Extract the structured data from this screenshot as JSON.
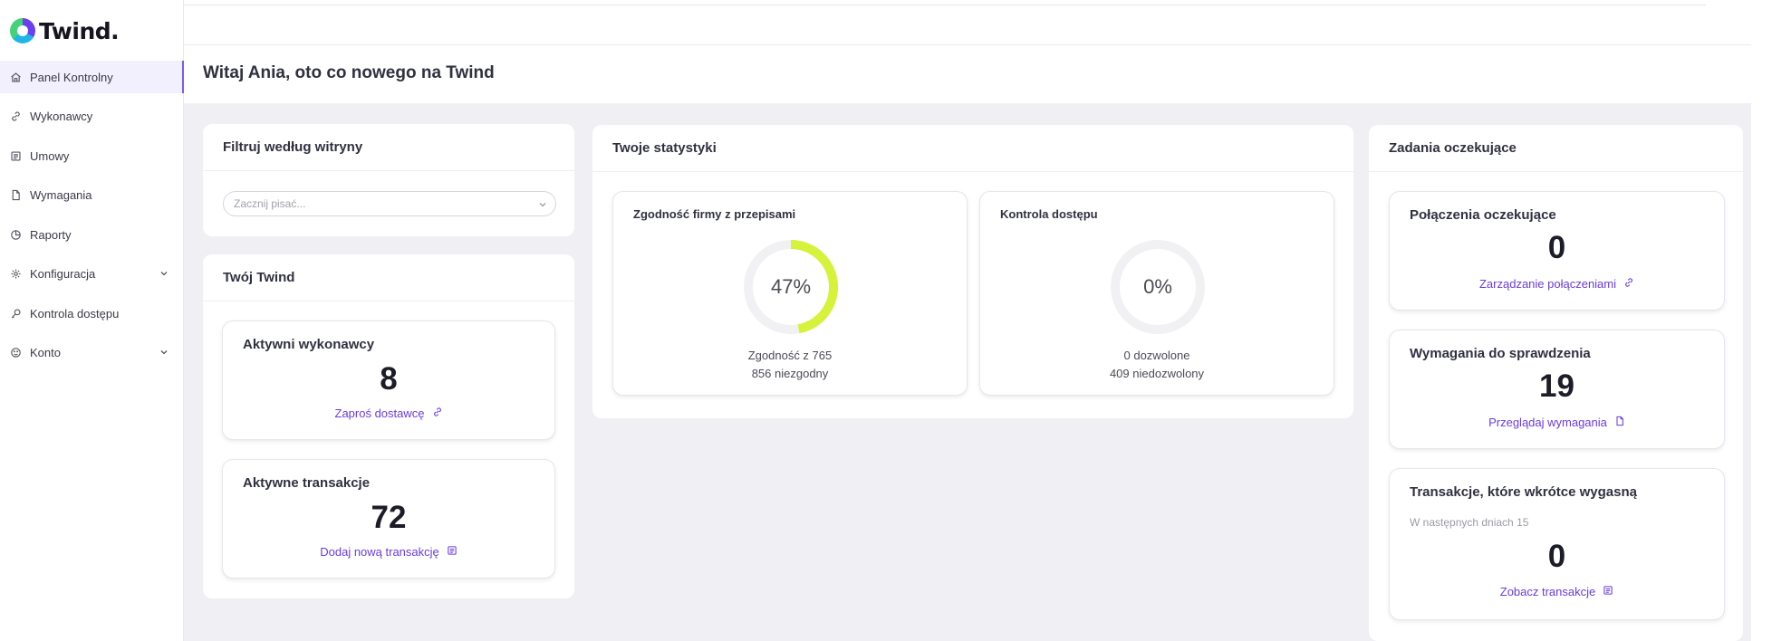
{
  "app": {
    "logo_text": "Twind."
  },
  "sidebar": {
    "items": [
      {
        "label": "Panel Kontrolny",
        "icon": "home-icon",
        "active": true
      },
      {
        "label": "Wykonawcy",
        "icon": "link-icon"
      },
      {
        "label": "Umowy",
        "icon": "document-list-icon"
      },
      {
        "label": "Wymagania",
        "icon": "file-icon"
      },
      {
        "label": "Raporty",
        "icon": "chart-pie-icon"
      },
      {
        "label": "Konfiguracja",
        "icon": "gear-icon",
        "expandable": true
      },
      {
        "label": "Kontrola dostępu",
        "icon": "key-icon"
      },
      {
        "label": "Konto",
        "icon": "user-circle-icon",
        "expandable": true
      }
    ]
  },
  "header": {
    "title": "Witaj Ania, oto co nowego na Twind"
  },
  "filter": {
    "title": "Filtruj według witryny",
    "placeholder": "Zacznij pisać..."
  },
  "your_twind": {
    "title": "Twój Twind",
    "cards": [
      {
        "title": "Aktywni wykonawcy",
        "value": "8",
        "link": "Zaproś dostawcę",
        "link_icon": "link-icon"
      },
      {
        "title": "Aktywne transakcje",
        "value": "72",
        "link": "Dodaj nową transakcję",
        "link_icon": "document-list-icon"
      }
    ]
  },
  "stats": {
    "title": "Twoje statystyki",
    "compliance": {
      "title": "Zgodność firmy z przepisami",
      "percent": 47,
      "percent_label": "47%",
      "line1": "Zgodność z 765",
      "line2": "856 niezgodny",
      "color": "#d7f23a"
    },
    "access": {
      "title": "Kontrola dostępu",
      "percent": 0,
      "percent_label": "0%",
      "line1": "0 dozwolone",
      "line2": "409 niedozwolony",
      "color": "#d7f23a"
    }
  },
  "pending": {
    "title": "Zadania oczekujące",
    "cards": [
      {
        "title": "Połączenia oczekujące",
        "value": "0",
        "link": "Zarządzanie połączeniami",
        "link_icon": "link-icon"
      },
      {
        "title": "Wymagania do sprawdzenia",
        "value": "19",
        "link": "Przeglądaj wymagania",
        "link_icon": "file-icon"
      },
      {
        "title": "Transakcje, które wkrótce wygasną",
        "subtitle": "W następnych dniach 15",
        "value": "0",
        "link": "Zobacz transakcje",
        "link_icon": "document-list-icon"
      }
    ]
  },
  "colors": {
    "accent": "#6a3ce0",
    "background": "#f0f0f4",
    "donut_track": "#f1f1f3"
  }
}
